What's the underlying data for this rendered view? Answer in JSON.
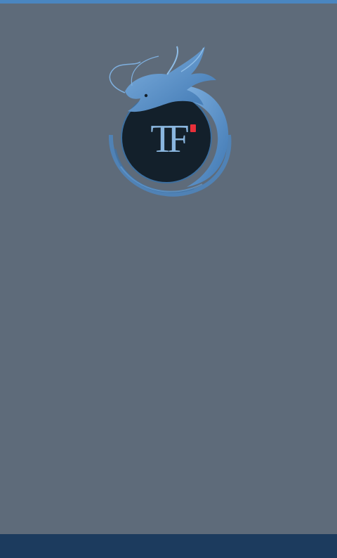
{
  "app": {
    "logo_text": "TF",
    "logo_name": "dragon-emblem",
    "seal_name": "red-seal-stamp"
  },
  "colors": {
    "background": "#5e6b7a",
    "top_accent": "#4a86c0",
    "bottom_bar": "#1c3b5e",
    "logo_circle": "#13202b",
    "dragon": "#5b95cf",
    "monogram": "#8ab6df",
    "seal": "#e8303a"
  }
}
